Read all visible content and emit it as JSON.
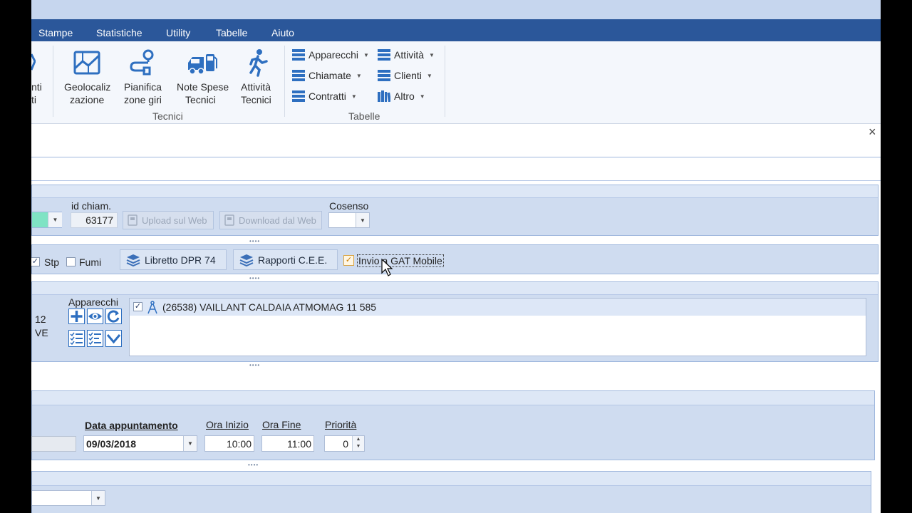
{
  "menu": {
    "items": [
      {
        "label": "Stampe"
      },
      {
        "label": "Statistiche"
      },
      {
        "label": "Utility"
      },
      {
        "label": "Tabelle"
      },
      {
        "label": "Aiuto"
      }
    ]
  },
  "ribbon": {
    "partial_btn": {
      "line1": "nti",
      "line2": "ti"
    },
    "tecnici": {
      "group_label": "Tecnici",
      "buttons": [
        {
          "line1": "Geolocaliz",
          "line2": "zazione"
        },
        {
          "line1": "Pianifica",
          "line2": "zone giri"
        },
        {
          "line1": "Note Spese",
          "line2": "Tecnici"
        },
        {
          "line1": "Attività",
          "line2": "Tecnici"
        }
      ]
    },
    "tabelle": {
      "group_label": "Tabelle",
      "items": [
        {
          "label": "Apparecchi"
        },
        {
          "label": "Chiamate"
        },
        {
          "label": "Contratti"
        },
        {
          "label": "Attività"
        },
        {
          "label": "Clienti"
        },
        {
          "label": "Altro"
        }
      ]
    }
  },
  "close_glyph": "×",
  "form": {
    "id_chiam_label": "id chiam.",
    "id_chiam_value": "63177",
    "upload_btn": "Upload sul Web",
    "download_btn": "Download dal Web",
    "cosenso_label": "Cosenso",
    "stp_label": "Stp",
    "fumi_label": "Fumi",
    "libretto_btn": "Libretto DPR 74",
    "rapporti_btn": "Rapporti C.E.E.",
    "invio_label": "Invio a GAT Mobile",
    "partial_12": "12",
    "partial_ve": "VE",
    "apparecchi_label": "Apparecchi",
    "apparecchi_list": [
      {
        "text": "(26538) VAILLANT CALDAIA ATMOMAG 11 585"
      }
    ],
    "data_appuntamento_label": "Data appuntamento",
    "data_appuntamento_value": "09/03/2018",
    "ora_inizio_label": "Ora Inizio",
    "ora_inizio_value": "10:00",
    "ora_fine_label": "Ora Fine",
    "ora_fine_value": "11:00",
    "priorita_label": "Priorità",
    "priorita_value": "0"
  },
  "colors": {
    "menu_bar": "#2b579a",
    "panel": "#cfdcf0",
    "accent_green": "#7fe3c4"
  }
}
